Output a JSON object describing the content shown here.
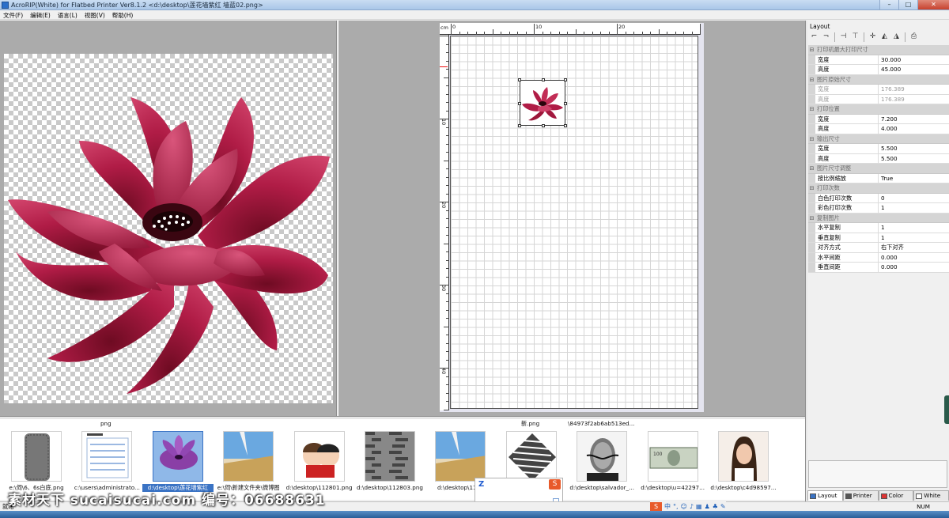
{
  "window": {
    "title": "AcroRIP(White) for Flatbed Printer Ver8.1.2 <d:\\desktop\\莲花墙紫红 墙蓝02.png>"
  },
  "menu": [
    "文件(F)",
    "编辑(E)",
    "语言(L)",
    "视图(V)",
    "帮助(H)"
  ],
  "ruler": {
    "unit": "cm",
    "top_labels": [
      "0",
      "10",
      "20"
    ],
    "left_labels": [
      "10",
      "20",
      "30",
      "40"
    ]
  },
  "layout_panel": {
    "header": "Layout",
    "toolbar_icons": [
      "align-left-top-icon",
      "align-right-top-icon",
      "center-h-icon",
      "center-v-icon",
      "center-icon",
      "mirror-icon",
      "flip-icon",
      "print-icon"
    ],
    "categories": [
      {
        "label": "打印机最大打印尺寸",
        "rows": [
          {
            "key": "宽度",
            "value": "30.000"
          },
          {
            "key": "高度",
            "value": "45.000"
          }
        ]
      },
      {
        "label": "图片原始尺寸",
        "dim": true,
        "rows": [
          {
            "key": "宽度",
            "value": "176.389"
          },
          {
            "key": "高度",
            "value": "176.389"
          }
        ]
      },
      {
        "label": "打印位置",
        "rows": [
          {
            "key": "宽度",
            "value": "7.200"
          },
          {
            "key": "高度",
            "value": "4.000"
          }
        ]
      },
      {
        "label": "输出尺寸",
        "rows": [
          {
            "key": "宽度",
            "value": "5.500"
          },
          {
            "key": "高度",
            "value": "5.500"
          }
        ]
      },
      {
        "label": "图片尺寸调整",
        "rows": [
          {
            "key": "按比例缩放",
            "value": "True"
          }
        ]
      },
      {
        "label": "打印次数",
        "rows": [
          {
            "key": "白色打印次数",
            "value": "0"
          },
          {
            "key": "彩色打印次数",
            "value": "1"
          }
        ]
      },
      {
        "label": "复制图片",
        "rows": [
          {
            "key": "水平复制",
            "value": "1"
          },
          {
            "key": "垂直复制",
            "value": "1"
          },
          {
            "key": "对齐方式",
            "value": "右下对齐"
          },
          {
            "key": "水平间距",
            "value": "0.000"
          },
          {
            "key": "垂直间距",
            "value": "0.000"
          }
        ]
      }
    ],
    "tabs": [
      {
        "label": "Layout",
        "icon": "layout-tab-icon",
        "active": true
      },
      {
        "label": "Printer",
        "icon": "printer-tab-icon",
        "active": false
      },
      {
        "label": "Color",
        "icon": "color-tab-icon",
        "active": false
      },
      {
        "label": "White",
        "icon": "white-tab-icon",
        "active": false
      }
    ]
  },
  "thumbnails": {
    "top_labels": [
      {
        "text": "png"
      },
      {
        "text": "新.png"
      },
      {
        "text": "\\84973f2ab6ab513ed..."
      }
    ],
    "items": [
      {
        "label": "e:\\伺\\6、6s白底.png",
        "kind": "phone-case",
        "selected": false
      },
      {
        "label": "c:\\users\\administrato...",
        "kind": "document",
        "selected": false
      },
      {
        "label": "d:\\desktop\\莲花墙紫红",
        "kind": "flower",
        "selected": true
      },
      {
        "label": "e:\\伺\\新建文件夹\\微博图",
        "kind": "sky",
        "selected": false
      },
      {
        "label": "d:\\desktop\\112801.png",
        "kind": "cartoon",
        "selected": false
      },
      {
        "label": "d:\\desktop\\112803.png",
        "kind": "pattern",
        "selected": false
      },
      {
        "label": "d:\\desktop\\1128",
        "kind": "sky",
        "selected": false
      },
      {
        "label": "",
        "kind": "zebra",
        "selected": false
      },
      {
        "label": "d:\\desktop\\salvador_...",
        "kind": "portrait",
        "selected": false
      },
      {
        "label": "d:\\desktop\\u=42297...",
        "kind": "banknote",
        "selected": false
      },
      {
        "label": "d:\\desktop\\c4d98597...",
        "kind": "woman",
        "selected": false
      }
    ]
  },
  "ime_popup": {
    "letter": "Z",
    "logo": "S"
  },
  "status": {
    "left": "就绪",
    "right": "NUM",
    "ime_mode": "中"
  },
  "watermark": "素材天下 sucaisucai.com   编号：06688631",
  "colors": {
    "flower": "#a3183e",
    "accent": "#3a73c4"
  }
}
